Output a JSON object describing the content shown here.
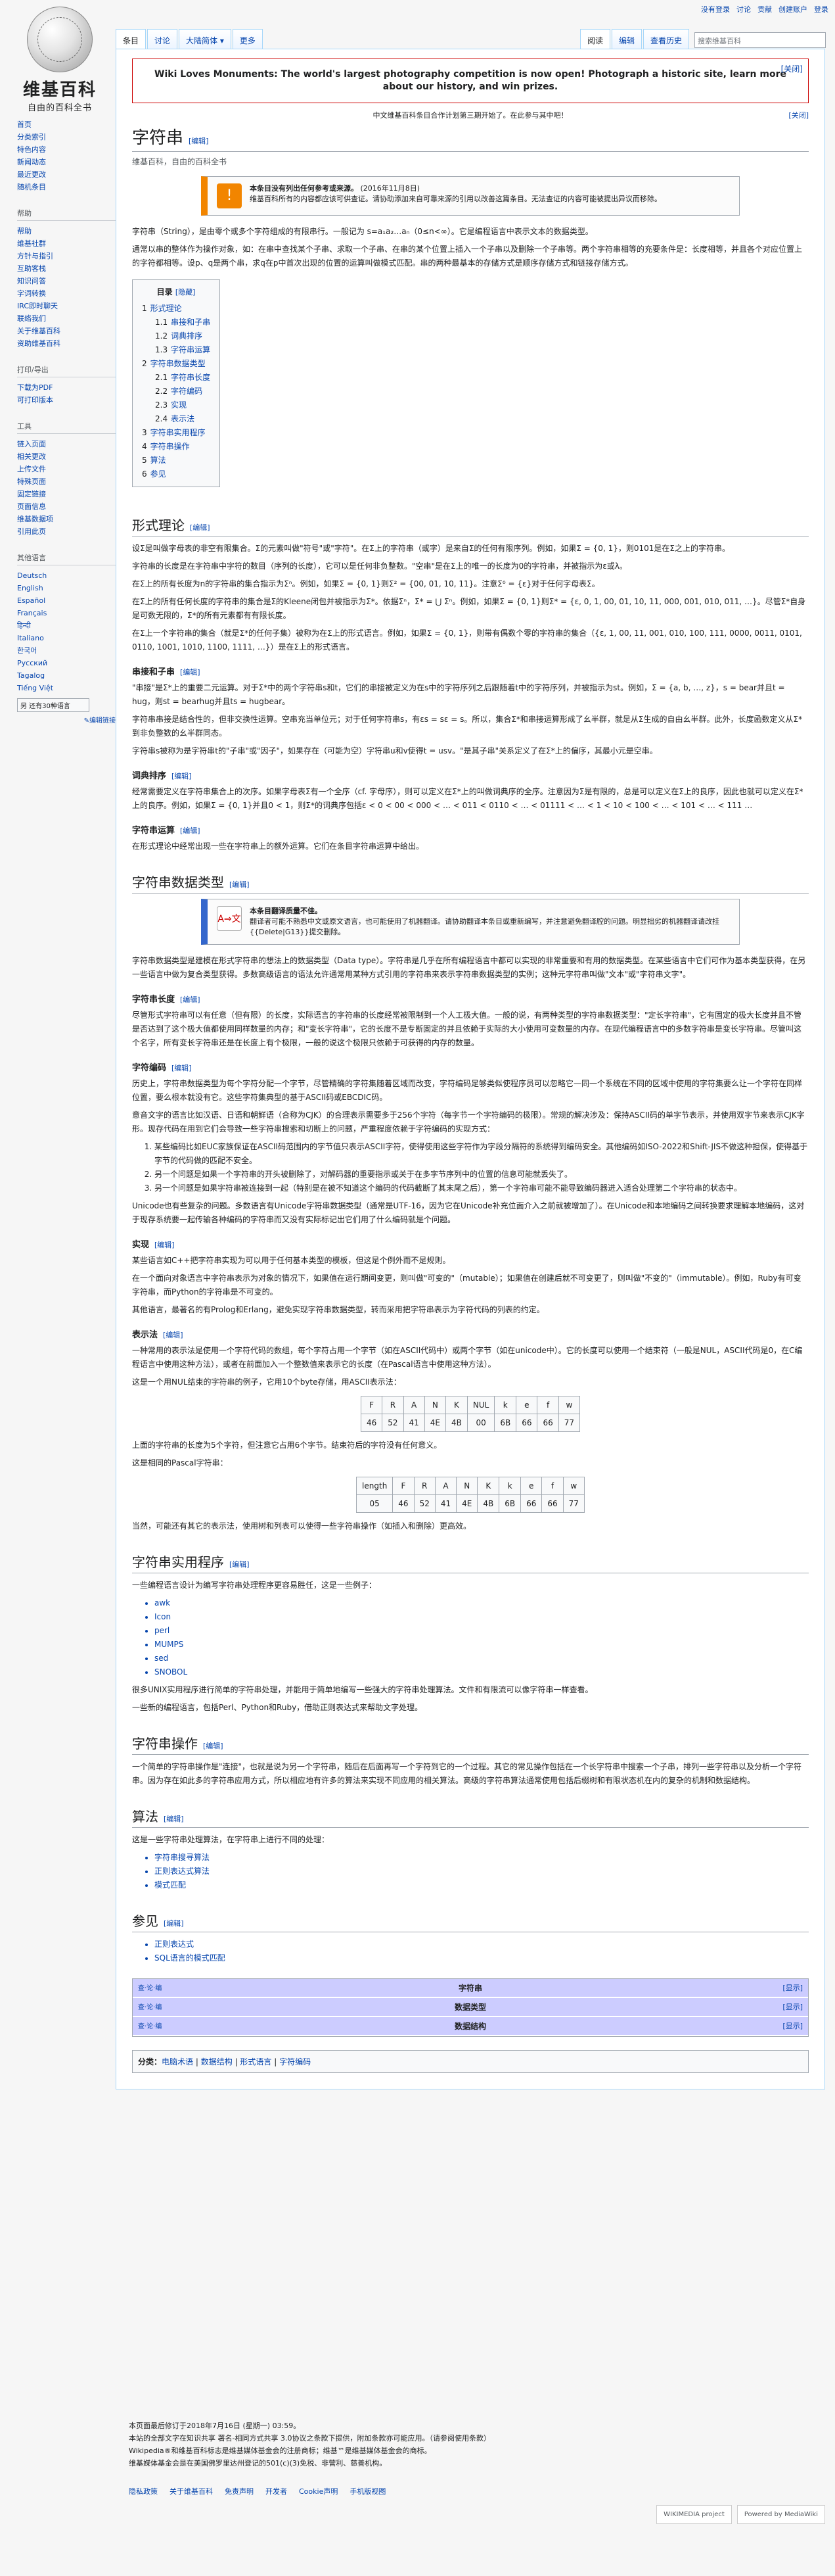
{
  "personal": [
    "没有登录",
    "讨论",
    "贡献",
    "创建账户",
    "登录"
  ],
  "logo": {
    "title": "维基百科",
    "subtitle": "自由的百科全书"
  },
  "sidebar": {
    "nav": [
      "首页",
      "分类索引",
      "特色内容",
      "新闻动态",
      "最近更改",
      "随机条目"
    ],
    "help_heading": "帮助",
    "help": [
      "帮助",
      "维基社群",
      "方针与指引",
      "互助客栈",
      "知识问答",
      "字词转换",
      "IRC即时聊天",
      "联络我们",
      "关于维基百科",
      "资助维基百科"
    ],
    "print_heading": "打印/导出",
    "print": [
      "下载为PDF",
      "可打印版本"
    ],
    "tools_heading": "工具",
    "tools": [
      "链入页面",
      "相关更改",
      "上传文件",
      "特殊页面",
      "固定链接",
      "页面信息",
      "维基数据项",
      "引用此页"
    ],
    "lang_heading": "其他语言",
    "langs": [
      "Deutsch",
      "English",
      "Español",
      "Français",
      "हिन्दी",
      "Italiano",
      "한국어",
      "Русский",
      "Tagalog",
      "Tiếng Việt"
    ],
    "more_langs": "另 还有30种语言",
    "edit_links": "✎编辑链接"
  },
  "tabs": {
    "left": [
      "条目",
      "讨论",
      "大陆简体 ▾",
      "更多"
    ],
    "right": [
      "阅读",
      "编辑",
      "查看历史"
    ],
    "search_placeholder": "搜索维基百科"
  },
  "banner": {
    "text": "Wiki Loves Monuments: The world's largest photography competition is now open! Photograph a historic site, learn more about our history, and win prizes.",
    "close": "[关闭]"
  },
  "notice": {
    "text": "中文维基百科条目合作计划第三期开始了。在此参与其中吧！",
    "close": "[关闭]"
  },
  "title": "字符串",
  "edit": "[编辑]",
  "tagline": "维基百科，自由的百科全书",
  "ambox1": {
    "title": "本条目没有列出任何参考或来源。",
    "date": "(2016年11月8日)",
    "text": "维基百科所有的内容都应该可供查证。请协助添加来自可靠来源的引用以改善这篇条目。无法查证的内容可能被提出异议而移除。"
  },
  "intro1": "字符串（String），是由零个或多个字符组成的有限串行。一般记为 s=a₁a₂…aₙ（0≤n<∞）。它是编程语言中表示文本的数据类型。",
  "intro2": "通常以串的整体作为操作对象，如：在串中查找某个子串、求取一个子串、在串的某个位置上插入一个子串以及删除一个子串等。两个字符串相等的充要条件是：长度相等，并且各个对应位置上的字符都相等。设p、q是两个串，求q在p中首次出现的位置的运算叫做模式匹配。串的两种最基本的存储方式是顺序存储方式和链接存储方式。",
  "toc": {
    "title": "目录",
    "hide": "[隐藏]",
    "items": [
      {
        "n": "1",
        "t": "形式理论",
        "l": 1
      },
      {
        "n": "1.1",
        "t": "串接和子串",
        "l": 2
      },
      {
        "n": "1.2",
        "t": "词典排序",
        "l": 2
      },
      {
        "n": "1.3",
        "t": "字符串运算",
        "l": 2
      },
      {
        "n": "2",
        "t": "字符串数据类型",
        "l": 1
      },
      {
        "n": "2.1",
        "t": "字符串长度",
        "l": 2
      },
      {
        "n": "2.2",
        "t": "字符编码",
        "l": 2
      },
      {
        "n": "2.3",
        "t": "实现",
        "l": 2
      },
      {
        "n": "2.4",
        "t": "表示法",
        "l": 2
      },
      {
        "n": "3",
        "t": "字符串实用程序",
        "l": 1
      },
      {
        "n": "4",
        "t": "字符串操作",
        "l": 1
      },
      {
        "n": "5",
        "t": "算法",
        "l": 1
      },
      {
        "n": "6",
        "t": "参见",
        "l": 1
      }
    ]
  },
  "s1": {
    "h": "形式理论",
    "p1": "设Σ是叫做字母表的非空有限集合。Σ的元素叫做\"符号\"或\"字符\"。在Σ上的字符串（或字）是来自Σ的任何有限序列。例如，如果Σ = {0, 1}，则0101是在Σ之上的字符串。",
    "p2": "字符串的长度是在字符串中字符的数目（序列的长度），它可以是任何非负整数。\"空串\"是在Σ上的唯一的长度为0的字符串，并被指示为ε或λ。",
    "p3": "在Σ上的所有长度为n的字符串的集合指示为Σⁿ。例如，如果Σ = {0, 1}则Σ² = {00, 01, 10, 11}。注意Σ⁰ = {ε}对于任何字母表Σ。",
    "p4": "在Σ上的所有任何长度的字符串的集合是Σ的Kleene闭包并被指示为Σ*。依据Σⁿ，Σ* = ⋃ Σⁿ。例如，如果Σ = {0, 1}则Σ* = {ε, 0, 1, 00, 01, 10, 11, 000, 001, 010, 011, …}。尽管Σ*自身是可数无限的，Σ*的所有元素都有有限长度。",
    "p5": "在Σ上一个字符串的集合（就是Σ*的任何子集）被称为在Σ上的形式语言。例如，如果Σ = {0, 1}，则带有偶数个零的字符串的集合（{ε, 1, 00, 11, 001, 010, 100, 111, 0000, 0011, 0101, 0110, 1001, 1010, 1100, 1111, …}）是在Σ上的形式语言。"
  },
  "s11": {
    "h": "串接和子串",
    "p1": "\"串接\"是Σ*上的重要二元运算。对于Σ*中的两个字符串s和t，它们的串接被定义为在s中的字符序列之后跟随着t中的字符序列，并被指示为st。例如，Σ = {a, b, …, z}，s = bear并且t = hug，则st = bearhug并且ts = hugbear。",
    "p2": "字符串串接是结合性的，但非交换性运算。空串充当单位元；对于任何字符串s，有εs = sε = s。所以，集合Σ*和串接运算形成了幺半群，就是从Σ生成的自由幺半群。此外，长度函数定义从Σ*到非负整数的幺半群同态。",
    "p3": "字符串s被称为是字符串t的\"子串\"或\"因子\"，如果存在（可能为空）字符串u和v使得t = usv。\"是其子串\"关系定义了在Σ*上的偏序，其最小元是空串。"
  },
  "s12": {
    "h": "词典排序",
    "p1": "经常需要定义在字符串集合上的次序。如果字母表Σ有一个全序（cf. 字母序），则可以定义在Σ*上的叫做词典序的全序。注意因为Σ是有限的，总是可以定义在Σ上的良序，因此也就可以定义在Σ*上的良序。例如，如果Σ = {0, 1}并且0 < 1，则Σ*的词典序包括ε < 0 < 00 < 000 < … < 011 < 0110 < … < 01111 < … < 1 < 10 < 100 < … < 101 < … < 111 …"
  },
  "s13": {
    "h": "字符串运算",
    "p1": "在形式理论中经常出现一些在字符串上的额外运算。它们在条目字符串运算中给出。"
  },
  "s2": {
    "h": "字符串数据类型",
    "ambox_title": "本条目翻译质量不佳。",
    "ambox_text": "翻译者可能不熟悉中文或原文语言，也可能使用了机器翻译。请协助翻译本条目或重新编写，并注意避免翻译腔的问题。明显拙劣的机器翻译请改挂{{Delete|G13}}提交删除。",
    "p1": "字符串数据类型是建模在形式字符串的想法上的数据类型（Data type）。字符串是几乎在所有编程语言中都可以实现的非常重要和有用的数据类型。在某些语言中它们可作为基本类型获得，在另一些语言中做为复合类型获得。多数高级语言的语法允许通常用某种方式引用的字符串来表示字符串数据类型的实例；这种元字符串叫做\"文本\"或\"字符串文字\"。"
  },
  "s21": {
    "h": "字符串长度",
    "p1": "尽管形式字符串可以有任意（但有限）的长度，实际语言的字符串的长度经常被限制到一个人工极大值。一般的说，有两种类型的字符串数据类型：\"定长字符串\"，它有固定的极大长度并且不管是否达到了这个极大值都使用同样数量的内存；和\"变长字符串\"，它的长度不是专断固定的并且依赖于实际的大小使用可变数量的内存。在现代编程语言中的多数字符串是变长字符串。尽管叫这个名字，所有变长字符串还是在长度上有个极限，一般的说这个极限只依赖于可获得的内存的数量。"
  },
  "s22": {
    "h": "字符编码",
    "p1": "历史上，字符串数据类型为每个字符分配一个字节，尽管精确的字符集随着区域而改变，字符编码足够类似使程序员可以忽略它—同一个系统在不同的区域中使用的字符集要么让一个字符在同样位置，要么根本就没有它。这些字符集典型的基于ASCII码或EBCDIC码。",
    "p2": "意音文字的语言比如汉语、日语和朝鲜语（合称为CJK）的合理表示需要多于256个字符（每字节一个字符编码的极限）。常规的解决涉及：保持ASCII码的单字节表示，并使用双字节来表示CJK字形。现存代码在用到它们会导致一些字符串搜索和切断上的问题，严重程度依赖于字符编码的实现方式：",
    "list": [
      "某些编码比如EUC家族保证在ASCII码范围内的字节值只表示ASCII字符，使得使用这些字符作为字段分隔符的系统得到编码安全。其他编码如ISO-2022和Shift-JIS不做这种担保，使得基于字节的代码做的匹配不安全。",
      "另一个问题是如果一个字符串的开头被删除了，对解码器的重要指示或关于在多字节序列中的位置的信息可能就丢失了。",
      "另一个问题是如果字符串被连接到一起（特别是在被不知道这个编码的代码截断了其末尾之后），第一个字符串可能不能导致编码器进入适合处理第二个字符串的状态中。"
    ],
    "p3": "Unicode也有些复杂的问题。多数语言有Unicode字符串数据类型（通常是UTF-16，因为它在Unicode补充位面介入之前就被增加了）。在Unicode和本地编码之间转换要求理解本地编码，这对于现存系统要一起传输各种编码的字符串而又没有实际标记出它们用了什么编码就是个问题。"
  },
  "s23": {
    "h": "实现",
    "p1": "某些语言如C++把字符串实现为可以用于任何基本类型的模板，但这是个例外而不是规则。",
    "p2": "在一个面向对象语言中字符串表示为对象的情况下，如果值在运行期间变更，则叫做\"可变的\"（mutable）；如果值在创建后就不可变更了，则叫做\"不变的\"（immutable）。例如，Ruby有可变字符串，而Python的字符串是不可变的。",
    "p3": "其他语言，最著名的有Prolog和Erlang，避免实现字符串数据类型，转而采用把字符串表示为字符代码的列表的约定。"
  },
  "s24": {
    "h": "表示法",
    "p1": "一种常用的表示法是使用一个字符代码的数组，每个字符占用一个字节（如在ASCII代码中）或两个字节（如在unicode中）。它的长度可以使用一个结束符（一般是NUL，ASCII代码是0，在C编程语言中使用这种方法），或者在前面加入一个整数值来表示它的长度（在Pascal语言中使用这种方法）。",
    "p2": "这是一个用NUL结束的字符串的例子，它用10个byte存储，用ASCII表示法：",
    "t1": [
      "F",
      "R",
      "A",
      "N",
      "K",
      "NUL",
      "k",
      "e",
      "f",
      "w",
      "46",
      "52",
      "41",
      "4E",
      "4B",
      "00",
      "6B",
      "66",
      "66",
      "77"
    ],
    "p3": "上面的字符串的长度为5个字符，但注意它占用6个字节。结束符后的字符没有任何意义。",
    "p4": "这是相同的Pascal字符串：",
    "t2": [
      "length",
      "F",
      "R",
      "A",
      "N",
      "K",
      "k",
      "e",
      "f",
      "w",
      "05",
      "46",
      "52",
      "41",
      "4E",
      "4B",
      "6B",
      "66",
      "66",
      "77"
    ],
    "p5": "当然，可能还有其它的表示法，使用树和列表可以使得一些字符串操作（如插入和删除）更高效。"
  },
  "s3": {
    "h": "字符串实用程序",
    "p1": "一些编程语言设计为编写字符串处理程序更容易胜任，这是一些例子：",
    "list": [
      "awk",
      "Icon",
      "perl",
      "MUMPS",
      "sed",
      "SNOBOL"
    ],
    "p2": "很多UNIX实用程序进行简单的字符串处理，并能用于简单地编写一些强大的字符串处理算法。文件和有限流可以像字符串一样查看。",
    "p3": "一些新的编程语言，包括Perl、Python和Ruby，借助正则表达式来帮助文字处理。"
  },
  "s4": {
    "h": "字符串操作",
    "p1": "一个简单的字符串操作是\"连接\"，也就是说为另一个字符串，随后在后面再写一个字符到它的一个过程。其它的常见操作包括在一个长字符串中搜索一个子串，排列一些字符串以及分析一个字符串。因为存在如此多的字符串应用方式，所以相应地有许多的算法来实现不同应用的相关算法。高级的字符串算法通常使用包括后缀树和有限状态机在内的复杂的机制和数据结构。"
  },
  "s5": {
    "h": "算法",
    "p1": "这是一些字符串处理算法，在字符串上进行不同的处理：",
    "list": [
      "字符串搜寻算法",
      "正则表达式算法",
      "模式匹配"
    ]
  },
  "s6": {
    "h": "参见",
    "list": [
      "正则表达式",
      "SQL语言的模式匹配"
    ]
  },
  "navbox": [
    {
      "l": "查·论·编",
      "t": "字符串",
      "r": "[显示]"
    },
    {
      "l": "查·论·编",
      "t": "数据类型",
      "r": "[显示]"
    },
    {
      "l": "查·论·编",
      "t": "数据结构",
      "r": "[显示]"
    }
  ],
  "cats": {
    "label": "分类：",
    "items": [
      "电脑术语",
      "数据结构",
      "形式语言",
      "字符编码"
    ]
  },
  "footer": {
    "lines": [
      "本页面最后修订于2018年7月16日 (星期一) 03:59。",
      "本站的全部文字在知识共享 署名-相同方式共享 3.0协议之条款下提供，附加条款亦可能应用。（请参阅使用条款）",
      "Wikipedia®和维基百科标志是维基媒体基金会的注册商标；维基™是维基媒体基金会的商标。",
      "维基媒体基金会是在美国佛罗里达州登记的501(c)(3)免税、非营利、慈善机构。"
    ],
    "links": [
      "隐私政策",
      "关于维基百科",
      "免责声明",
      "开发者",
      "Cookie声明",
      "手机版视图"
    ],
    "badges": [
      "WIKIMEDIA project",
      "Powered by MediaWiki"
    ]
  }
}
